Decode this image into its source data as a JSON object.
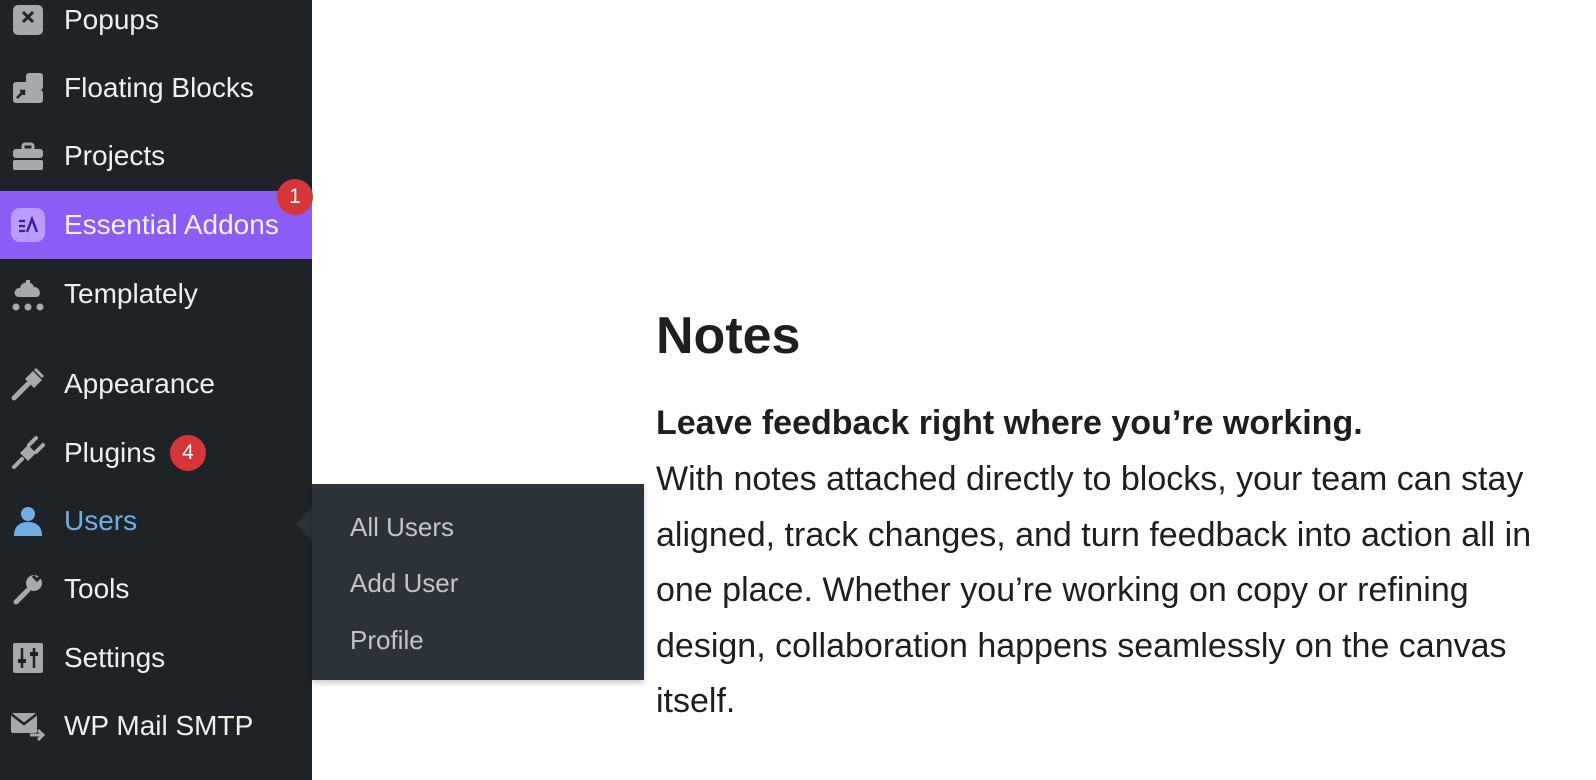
{
  "sidebar": {
    "items": [
      {
        "label": "Popups",
        "icon": "popup-close-icon"
      },
      {
        "label": "Floating Blocks",
        "icon": "floating-blocks-icon"
      },
      {
        "label": "Projects",
        "icon": "briefcase-icon"
      },
      {
        "label": "Essential Addons",
        "icon": "essential-addons-icon",
        "badge": "1",
        "current": true
      },
      {
        "label": "Templately",
        "icon": "templately-icon"
      },
      {
        "label": "Appearance",
        "icon": "paintbrush-icon"
      },
      {
        "label": "Plugins",
        "icon": "plug-icon",
        "badge": "4"
      },
      {
        "label": "Users",
        "icon": "user-icon",
        "open": true
      },
      {
        "label": "Tools",
        "icon": "wrench-icon"
      },
      {
        "label": "Settings",
        "icon": "sliders-icon"
      },
      {
        "label": "WP Mail SMTP",
        "icon": "mail-send-icon"
      }
    ]
  },
  "users_submenu": {
    "items": [
      "All Users",
      "Add User",
      "Profile"
    ]
  },
  "content": {
    "title": "Notes",
    "lead": "Leave feedback right where you’re working.",
    "body": "With notes attached directly to blocks, your team can stay aligned, track changes, and turn feedback into action all in one place. Whether you’re working on copy or refining design, collaboration happens seamlessly on the canvas itself."
  },
  "colors": {
    "sidebar_bg": "#1d2327",
    "submenu_bg": "#2c3338",
    "active_item_bg": "#8c5cf7",
    "badge_bg": "#d63638",
    "users_label": "#72aee6"
  }
}
